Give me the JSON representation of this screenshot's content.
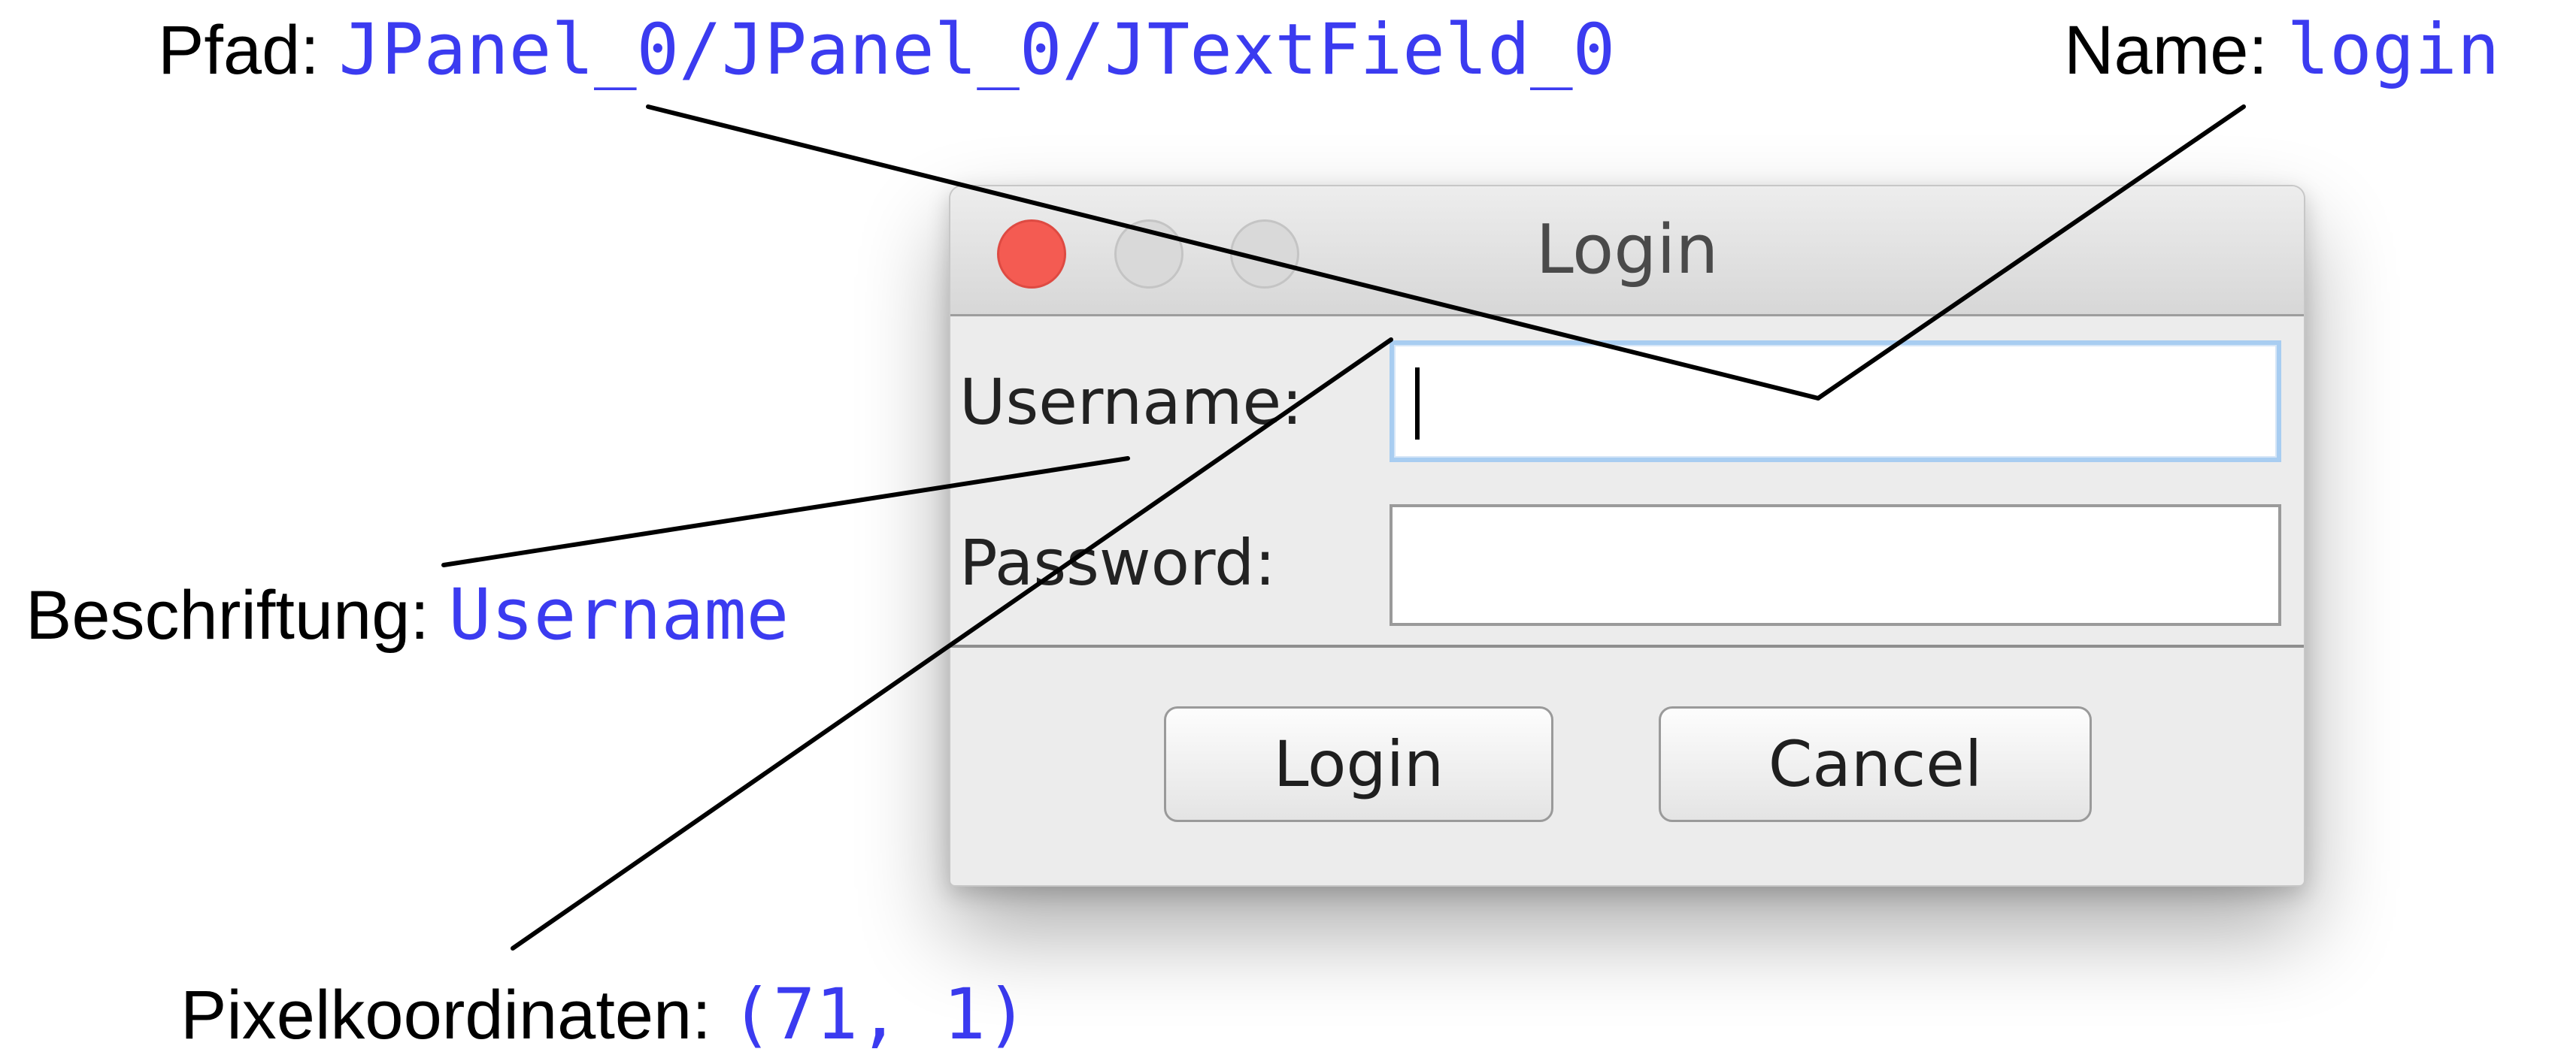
{
  "annotations": {
    "path": {
      "label": "Pfad:",
      "value": "JPanel_0/JPanel_0/JTextField_0"
    },
    "name": {
      "label": "Name:",
      "value": "login"
    },
    "caption": {
      "label": "Beschriftung:",
      "value": "Username"
    },
    "coords": {
      "label": "Pixelkoordinaten:",
      "value": "(71, 1)"
    }
  },
  "dialog": {
    "title": "Login",
    "username_label": "Username:",
    "password_label": "Password:",
    "username_value": "",
    "password_value": "",
    "login_button": "Login",
    "cancel_button": "Cancel"
  },
  "colors": {
    "annotation_value": "#3b3bf0",
    "close_button": "#f45b52",
    "focus_border": "#a8cdf1"
  }
}
